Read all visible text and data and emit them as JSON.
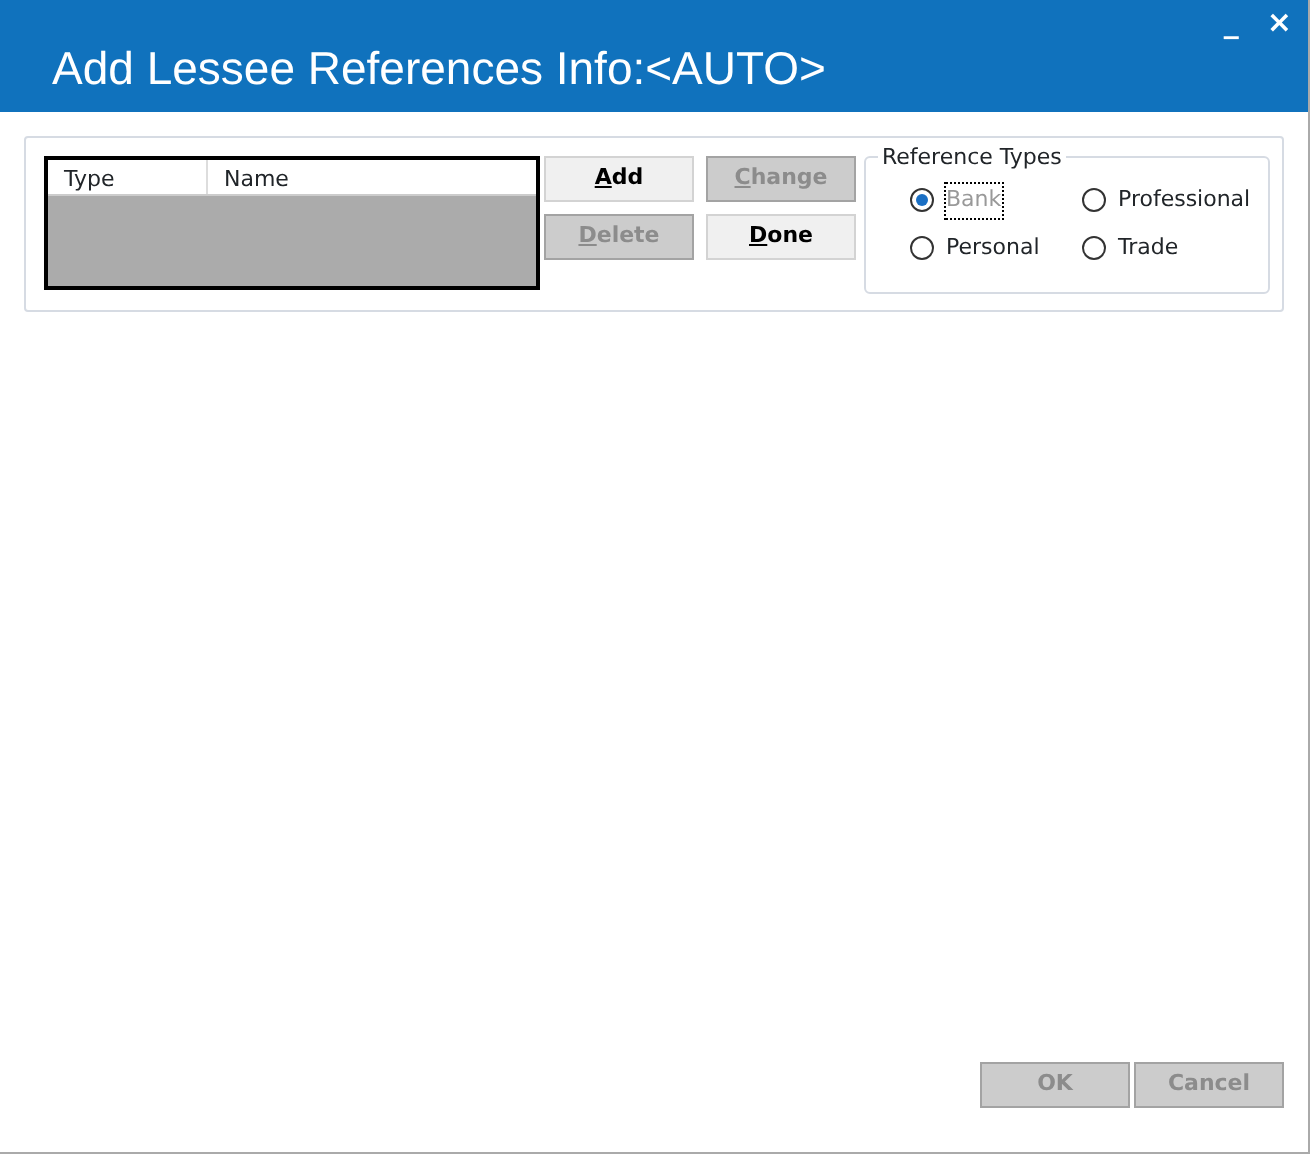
{
  "window": {
    "title": "Add Lessee References Info:<AUTO>",
    "controls": [
      "_",
      "×"
    ]
  },
  "table": {
    "columns": [
      "Type",
      "Name"
    ]
  },
  "buttons": [
    {
      "label": "Add",
      "disabled": false,
      "mnemonic": true
    },
    {
      "label": "Change",
      "disabled": true,
      "mnemonic": true
    },
    {
      "label": "Delete",
      "disabled": true,
      "mnemonic": true
    },
    {
      "label": "Done",
      "disabled": false,
      "mnemonic": true
    }
  ],
  "reference_types": {
    "title": "Reference Types",
    "options": [
      {
        "label": "Bank",
        "selected": true,
        "disabled": true,
        "focused": true
      },
      {
        "label": "Professional",
        "selected": false,
        "disabled": false,
        "focused": false
      },
      {
        "label": "Personal",
        "selected": false,
        "disabled": false,
        "focused": false
      },
      {
        "label": "Trade",
        "selected": false,
        "disabled": false,
        "focused": false
      }
    ]
  },
  "footer_buttons": [
    {
      "label": "OK",
      "disabled": true
    },
    {
      "label": "Cancel",
      "disabled": true
    }
  ]
}
